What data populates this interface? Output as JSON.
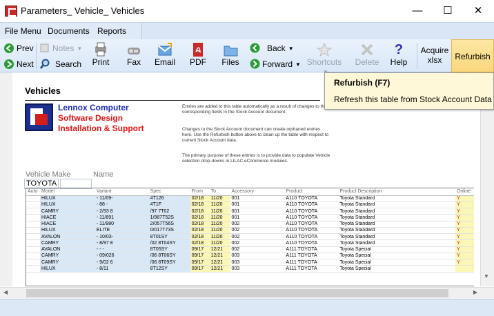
{
  "window": {
    "title": "Parameters_ Vehicle_ Vehicles",
    "minimize": "—",
    "maximize": "☐",
    "close": "✕"
  },
  "menu": {
    "items": [
      "File Menu",
      "Documents",
      "Reports"
    ]
  },
  "toolbar": {
    "prev": "Prev",
    "next": "Next",
    "notes": "Notes",
    "search": "Search",
    "print": "Print",
    "fax": "Fax",
    "email": "Email",
    "pdf": "PDF",
    "files": "Files",
    "back": "Back",
    "forward": "Forward",
    "shortcuts": "Shortcuts",
    "delete": "Delete",
    "help": "Help",
    "acquire": "Acquire",
    "xlsx": "xlsx",
    "refurbish": "Refurbish"
  },
  "tooltip": {
    "title": "Refurbish (F7)",
    "text": "Refresh this table from Stock Account Data"
  },
  "page": {
    "title": "Vehicles",
    "company": [
      "Lennox Computer",
      "Software Design",
      "Installation & Support"
    ],
    "info": [
      "Entries are added to this table automatically as a result of changes to the corresponding fields in the Stock Account document.",
      "Changes to the Stock Account document can create orphaned entries here. Use the Refurbish button above to clean up the table with respect to current Stock Account data.",
      "The primary purpose of these entries is to provide data to populate Vehicle selection drop-downs in LILAC eCommerce modules."
    ],
    "vehicle_make_label": "Vehicle Make",
    "name_label": "Name",
    "vehicle_make_value": "TOYOTA",
    "name_value": ""
  },
  "table": {
    "columns": [
      "Auto",
      "Model",
      "Variant",
      "Spec",
      "From",
      "To",
      "Accessory",
      "Product",
      "Product Description",
      "Online"
    ],
    "rows": [
      [
        "",
        "HILUX",
        "- 11/09-",
        "4T126",
        "02/18",
        "11/20",
        "001",
        "A110 TOYOTA",
        "Toyota Standard",
        "Y"
      ],
      [
        "",
        "HILUX",
        "- 88 -",
        "4T1F",
        "02/18",
        "11/20",
        "001",
        "A110 TOYOTA",
        "Toyota Standard",
        "Y"
      ],
      [
        "",
        "CAMRY",
        "- 2/93 8",
        "/97 7T02",
        "02/18",
        "11/20",
        "001",
        "A110 TOYOTA",
        "Toyota Standard",
        "Y"
      ],
      [
        "",
        "HIACE",
        "- 11/891",
        "1/987T52S",
        "02/18",
        "11/20",
        "001",
        "A110 TOYOTA",
        "Toyota Standard",
        "Y"
      ],
      [
        "",
        "HIACE",
        "- 11/980",
        "2/057T56S",
        "02/18",
        "11/20",
        "002",
        "A110 TOYOTA",
        "Toyota Standard",
        "Y"
      ],
      [
        "",
        "HILUX",
        "ELITE",
        "0/017T73S",
        "02/18",
        "11/20",
        "002",
        "A110 TOYOTA",
        "Toyota Standard",
        "Y"
      ],
      [
        "",
        "AVALON",
        "- 10/03-",
        "8T01SY",
        "02/18",
        "11/20",
        "002",
        "A110 TOYOTA",
        "Toyota Standard",
        "Y"
      ],
      [
        "",
        "CAMRY",
        "- 8/97 8",
        "/02 8T04SY",
        "02/18",
        "11/20",
        "002",
        "A110 TOYOTA",
        "Toyota Standard",
        "Y"
      ],
      [
        "",
        "AVALON",
        "- - -",
        "8T05SY",
        "09/17",
        "12/21",
        "002",
        "A111 TOYOTA",
        "Toyota Special",
        "Y"
      ],
      [
        "",
        "CAMRY",
        "- 09/026",
        "/06 8T06SY",
        "09/17",
        "12/21",
        "003",
        "A111 TOYOTA",
        "Toyota Special",
        "Y"
      ],
      [
        "",
        "CAMRY",
        "- 9/02 6",
        "/06 8T09SY",
        "09/17",
        "12/21",
        "003",
        "A111 TOYOTA",
        "Toyota Special",
        "Y"
      ],
      [
        "",
        "HILUX",
        "- 8/11",
        "8T12SY",
        "09/17",
        "12/21",
        "003",
        "A111 TOYOTA",
        "Toyota Special",
        ""
      ]
    ]
  }
}
